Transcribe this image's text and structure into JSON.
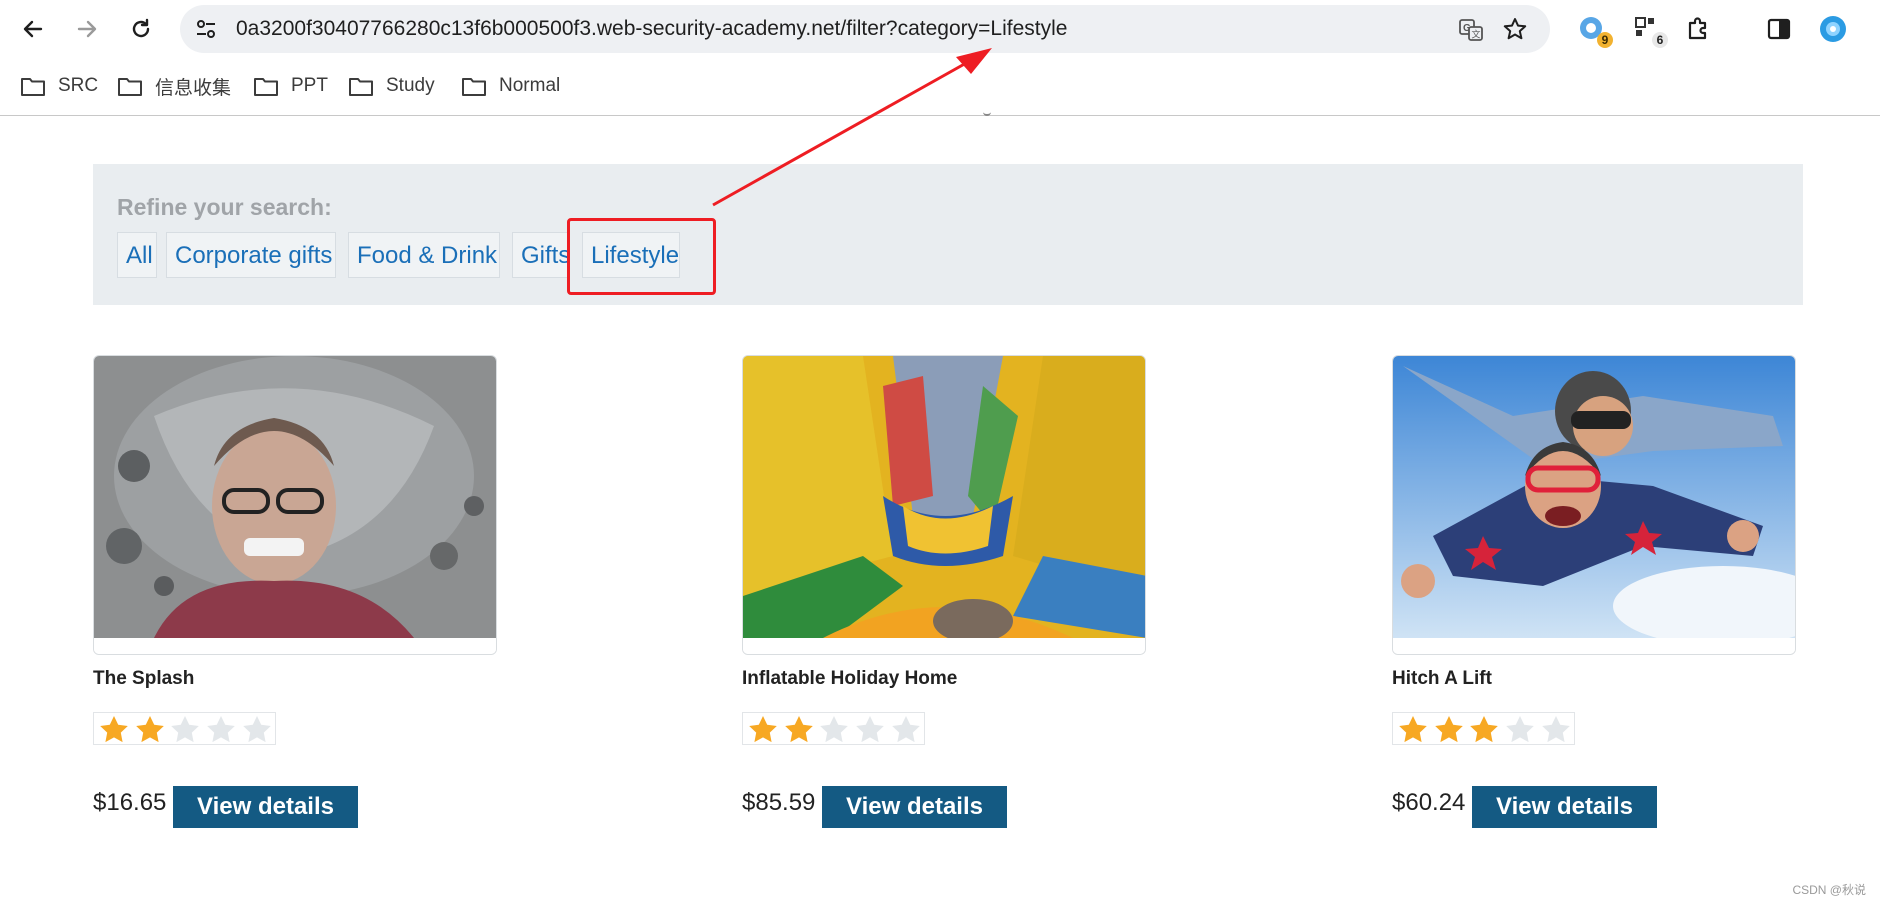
{
  "browser": {
    "url": "0a3200f30407766280c13f6b000500f3.web-security-academy.net/filter?category=Lifestyle",
    "extension_badges": [
      "9",
      "6"
    ],
    "bookmarks": [
      "SRC",
      "信息收集",
      "PPT",
      "Study",
      "Normal"
    ]
  },
  "filter": {
    "label": "Refine your search:",
    "categories": [
      "All",
      "Corporate gifts",
      "Food & Drink",
      "Gifts",
      "Lifestyle"
    ],
    "selected": "Lifestyle"
  },
  "products": [
    {
      "name": "The Splash",
      "rating": 2,
      "max_rating": 5,
      "price": "$16.65",
      "button": "View details"
    },
    {
      "name": "Inflatable Holiday Home",
      "rating": 2,
      "max_rating": 5,
      "price": "$85.59",
      "button": "View details"
    },
    {
      "name": "Hitch A Lift",
      "rating": 3,
      "max_rating": 5,
      "price": "$60.24",
      "button": "View details"
    }
  ],
  "watermark": "CSDN @秋说",
  "colors": {
    "link": "#1a6fb8",
    "button": "#145a83",
    "star_on": "#f7a823",
    "star_off": "#e3e7ea",
    "annotation": "#ee1d23",
    "filter_bg": "#e9edf0"
  }
}
